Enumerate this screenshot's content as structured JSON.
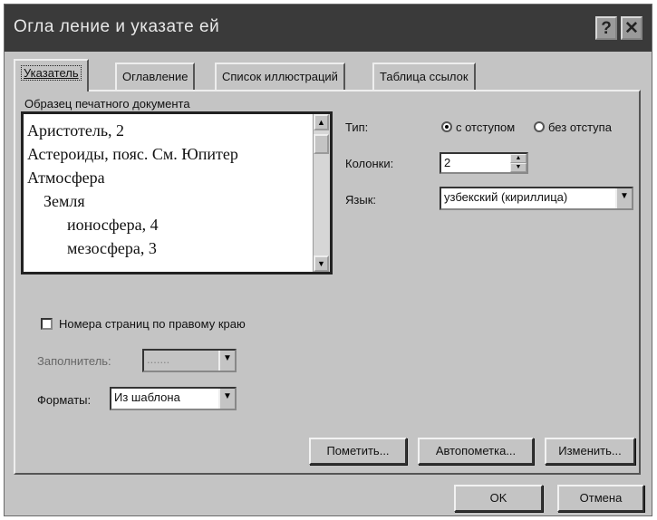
{
  "window": {
    "title": "Огла ление и указате ей",
    "help_label": "?",
    "close_label": "✕"
  },
  "tabs": [
    {
      "label": "Указатель",
      "active": true
    },
    {
      "label": "Оглавление",
      "active": false
    },
    {
      "label": "Список иллюстраций",
      "active": false
    },
    {
      "label": "Таблица ссылок",
      "active": false
    }
  ],
  "preview": {
    "label": "Образец печатного документа",
    "lines": [
      "Аристотель, 2",
      "Астероиды, пояс. См. Юпитер",
      "Атмосфера",
      "Земля",
      "ионосфера, 4",
      "мезосфера, 3"
    ]
  },
  "type": {
    "label": "Тип:",
    "option_indented": "с отступом",
    "option_run_in": "без отступа",
    "selected": "с отступом"
  },
  "columns": {
    "label": "Колонки:",
    "value": "2"
  },
  "language": {
    "label": "Язык:",
    "value": "узбекский (кириллица)"
  },
  "right_align": {
    "label": "Номера страниц по правому краю",
    "checked": false
  },
  "tab_leader": {
    "label": "Заполнитель:",
    "value": ".......",
    "enabled": false
  },
  "formats": {
    "label": "Форматы:",
    "value": "Из шаблона"
  },
  "actions": {
    "mark_entry": "Пометить...",
    "automark": "Автопометка...",
    "modify": "Изменить..."
  },
  "footer": {
    "ok": "OK",
    "cancel": "Отмена"
  }
}
